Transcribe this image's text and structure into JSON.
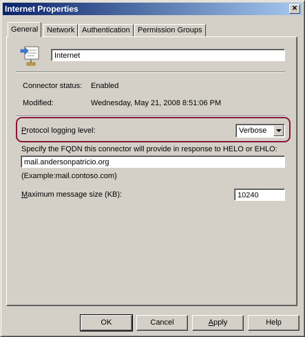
{
  "window": {
    "title": "Internet Properties",
    "close_glyph": "✕"
  },
  "tabs": [
    {
      "label": "General",
      "active": true
    },
    {
      "label": "Network"
    },
    {
      "label": "Authentication"
    },
    {
      "label": "Permission Groups"
    }
  ],
  "general": {
    "connector_name": "Internet",
    "connector_status_label": "Connector status:",
    "connector_status_value": "Enabled",
    "modified_label": "Modified:",
    "modified_value": "Wednesday, May 21, 2008 8:51:06 PM",
    "protocol_logging_label": "Protocol logging level:",
    "protocol_logging_value": "Verbose",
    "fqdn_label": "Specify the FQDN this connector will provide in response to HELO or EHLO:",
    "fqdn_value": "mail.andersonpatricio.org",
    "fqdn_example": "(Example:mail.contoso.com)",
    "max_size_label": "Maximum message size (KB):",
    "max_size_value": "10240"
  },
  "buttons": {
    "ok": "OK",
    "cancel": "Cancel",
    "apply": "Apply",
    "help": "Help"
  },
  "highlight_color": "#8a1538"
}
